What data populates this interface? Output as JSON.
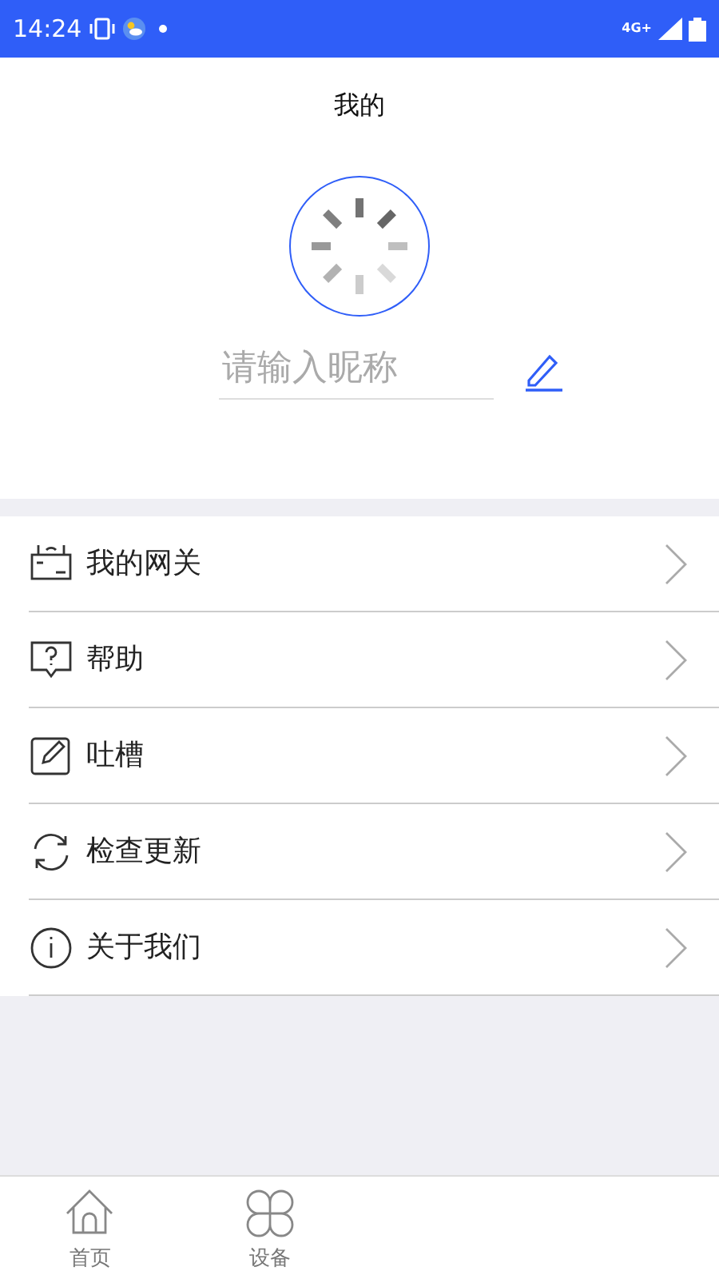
{
  "status_bar": {
    "time": "14:24",
    "network": "4G+"
  },
  "header": {
    "title": "我的"
  },
  "profile": {
    "nickname_placeholder": "请输入昵称"
  },
  "menu": [
    {
      "label": "我的网关"
    },
    {
      "label": "帮助"
    },
    {
      "label": "吐槽"
    },
    {
      "label": "检查更新"
    },
    {
      "label": "关于我们"
    }
  ],
  "tabbar": [
    {
      "label": "首页",
      "selected": false
    },
    {
      "label": "设备",
      "selected": false
    }
  ]
}
